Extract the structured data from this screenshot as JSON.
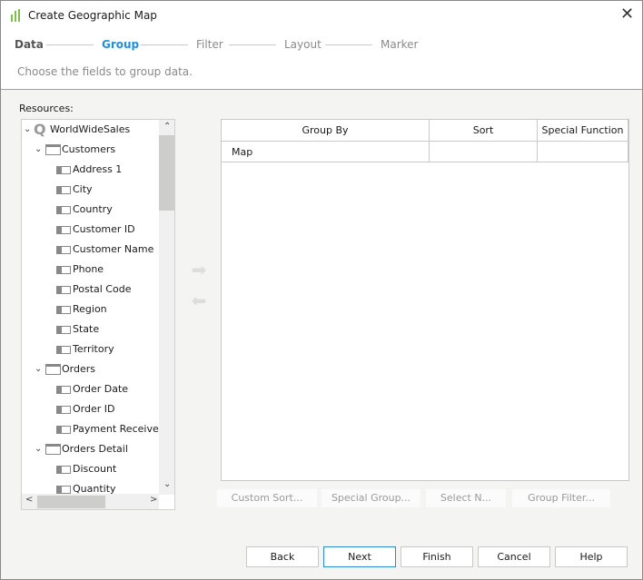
{
  "window": {
    "title": "Create Geographic Map",
    "close_icon": "close-icon",
    "app_icon": "chart-icon"
  },
  "steps": [
    {
      "label": "Data",
      "state": "done"
    },
    {
      "label": "Group",
      "state": "active"
    },
    {
      "label": "Filter",
      "state": "pending"
    },
    {
      "label": "Layout",
      "state": "pending"
    },
    {
      "label": "Marker",
      "state": "pending"
    }
  ],
  "description": "Choose the fields to group data.",
  "resources": {
    "label": "Resources:",
    "root": "WorldWideSales",
    "tables": [
      {
        "name": "Customers",
        "fields": [
          "Address 1",
          "City",
          "Country",
          "Customer ID",
          "Customer Name",
          "Phone",
          "Postal Code",
          "Region",
          "State",
          "Territory"
        ]
      },
      {
        "name": "Orders",
        "fields": [
          "Order Date",
          "Order ID",
          "Payment Received"
        ]
      },
      {
        "name": "Orders Detail",
        "fields": [
          "Discount",
          "Quantity"
        ]
      }
    ]
  },
  "grid": {
    "columns": [
      "Group By",
      "Sort",
      "Special Function"
    ],
    "rows": [
      [
        "Map",
        "",
        ""
      ]
    ]
  },
  "actions": {
    "custom_sort": "Custom Sort...",
    "special_group": "Special Group...",
    "select_n": "Select N...",
    "group_filter": "Group Filter..."
  },
  "buttons": {
    "back": "Back",
    "next": "Next",
    "finish": "Finish",
    "cancel": "Cancel",
    "help": "Help"
  },
  "colors": {
    "active_step": "#1e90e0",
    "accent": "#2a8ad4"
  }
}
